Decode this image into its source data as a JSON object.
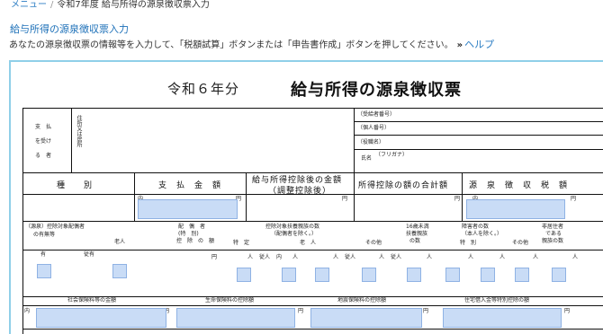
{
  "breadcrumb": {
    "menu": "メニュー",
    "separator": "/",
    "current": "令和7年度 給与所得の源泉徴収票入力"
  },
  "section_title": "給与所得の源泉徴収票入力",
  "instruction": {
    "text": "あなたの源泉徴収票の情報等を入力して、「税額試算」ボタンまたは「申告書作成」ボタンを押してください。",
    "arrow": "»",
    "help": "ヘルプ"
  },
  "form": {
    "title_wareki": "令和６年分",
    "title_main": "給与所得の源泉徴収票",
    "payer_label": [
      "支　払",
      "を受け",
      "る　者"
    ],
    "address_label": "住所又は居所",
    "recipient_no": "（受給者番号）",
    "personal_no": "（個人番号）",
    "position": "（役職名）",
    "name_label": "氏名",
    "furigana": "（フリガナ）",
    "headers": {
      "type": "種　　別",
      "payment": "支　払　金　額",
      "after_deduction_1": "給与所得控除後の金額",
      "after_deduction_2": "（調整控除後）",
      "deduction_total": "所得控除の額の合計額",
      "withholding": "源　泉　徴　収　税　額"
    },
    "unit_uchi": "内",
    "unit_yen": "円",
    "row2": {
      "spouse_label_1": "（源泉）控除対象配偶者",
      "spouse_label_2": "の有無等",
      "elderly": "老人",
      "spouse_ded_1": "配　偶　者",
      "spouse_ded_2": "(特　別)",
      "spouse_ded_3": "控　除　の　額",
      "dependents_1": "控除対象扶養親族の数",
      "dependents_2": "（配偶者を除く。）",
      "specific": "特　定",
      "elderly2": "老　人",
      "other": "その他",
      "under16_1": "16歳未満",
      "under16_2": "扶養親族",
      "under16_3": "の数",
      "disabled_1": "障害者の数",
      "disabled_2": "（本人を除く。）",
      "special": "特　別",
      "other2": "その他",
      "nonresident_1": "非居住者",
      "nonresident_2": "である",
      "nonresident_3": "親族の数"
    },
    "row3": {
      "yes": "有",
      "jukei": "従有",
      "person": "人",
      "jun": "従人",
      "uchi": "内"
    },
    "row4": {
      "social": "社会保険料等の金額",
      "life": "生命保険料の控除額",
      "earthquake": "地震保険料の控除額",
      "housing": "住宅借入金等特別控除の額"
    }
  }
}
